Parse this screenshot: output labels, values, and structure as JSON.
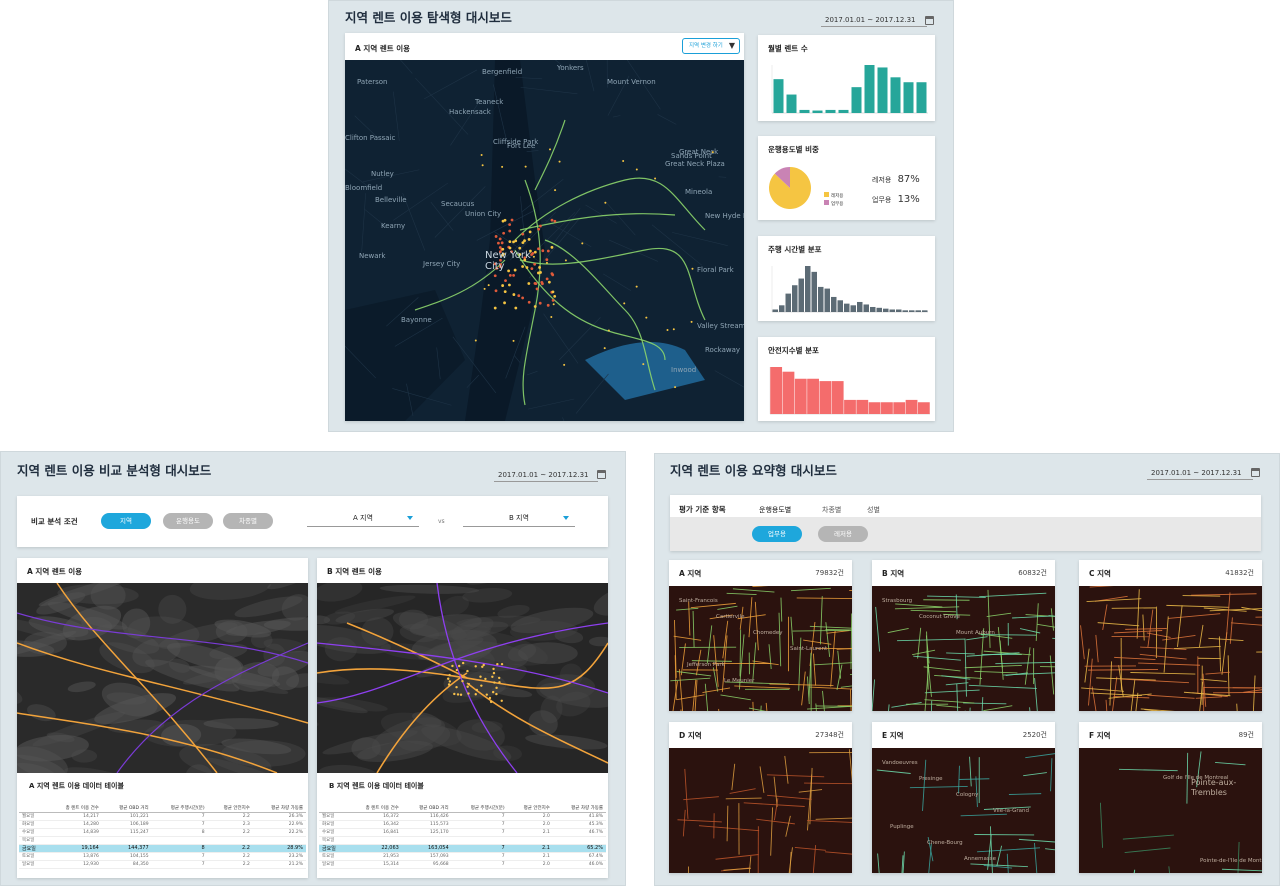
{
  "top": {
    "title": "지역 렌트 이용 탐색형 대시보드",
    "date_range": "2017.01.01 ~ 2017.12.31",
    "map_card": {
      "title": "A 지역 렌트 이용",
      "filter_button": "지역 변경 하기",
      "labels": [
        "Paterson",
        "Yonkers",
        "Bergenfield",
        "Mount Vernon",
        "Teaneck",
        "Hackensack",
        "Clifton Passaic",
        "Fort Lee",
        "Cliffside Park",
        "Nutley",
        "Bloomfield",
        "Belleville",
        "Secaucus",
        "Union City",
        "Kearny",
        "Newark",
        "Jersey City",
        "New York City",
        "Bayonne",
        "Great Neck",
        "Mineola",
        "Floral Park",
        "Valley Stream",
        "Sands Point",
        "Inwood",
        "Rockaway",
        "Great Neck Plaza",
        "New Hyde Park"
      ]
    },
    "monthly": {
      "title": "월별 렌트 수",
      "values": [
        55,
        30,
        5,
        4,
        5,
        5,
        42,
        78,
        74,
        58,
        50,
        50
      ],
      "color": "#26a69a"
    },
    "purpose": {
      "title": "운행용도별 비중",
      "items": [
        {
          "name": "레저용",
          "pct": "87%",
          "value": 87,
          "color": "#f5c542"
        },
        {
          "name": "업무용",
          "pct": "13%",
          "value": 13,
          "color": "#c983b4"
        }
      ]
    },
    "drive_time": {
      "title": "주행 시간별 분포",
      "values": [
        3,
        8,
        22,
        32,
        40,
        55,
        48,
        30,
        28,
        18,
        14,
        10,
        8,
        12,
        9,
        6,
        5,
        4,
        3,
        3,
        2,
        2,
        2,
        2
      ],
      "color": "#5c6b75"
    },
    "safety": {
      "title": "안전지수별 분포",
      "values": [
        40,
        36,
        30,
        30,
        28,
        28,
        12,
        12,
        10,
        10,
        10,
        12,
        10
      ],
      "color": "#f46c6c"
    }
  },
  "compare": {
    "title": "지역 렌트 이용 비교 분석형 대시보드",
    "date_range": "2017.01.01 ~ 2017.12.31",
    "condition_label": "비교 분석 조건",
    "pills": [
      {
        "label": "지역",
        "active": true
      },
      {
        "label": "운행용도",
        "active": false
      },
      {
        "label": "차종별",
        "active": false
      }
    ],
    "region_a": "A 지역",
    "vs": "vs",
    "region_b": "B 지역",
    "map_a_title": "A 지역 렌트 이용",
    "map_b_title": "B 지역 렌트 이용",
    "table_a": {
      "title": "A 지역 렌트 이용 데이터 테이블",
      "headers": [
        "",
        "총 렌트 이용 건수",
        "평균 OBD 거리",
        "평균 주행시간(분)",
        "평균 안전지수",
        "평균 차량 가동률"
      ],
      "rows": [
        [
          "월요일",
          "14,217",
          "101,221",
          "7",
          "2.2",
          "26.3%"
        ],
        [
          "화요일",
          "14,280",
          "106,189",
          "7",
          "2.3",
          "22.9%"
        ],
        [
          "수요일",
          "14,839",
          "115,247",
          "8",
          "2.2",
          "22.2%"
        ],
        [
          "목요일",
          "",
          "",
          "",
          "",
          ""
        ],
        [
          "금요일",
          "19,164",
          "144,377",
          "8",
          "2.2",
          "28.9%"
        ],
        [
          "토요일",
          "13,876",
          "104,155",
          "7",
          "2.2",
          "23.2%"
        ],
        [
          "일요일",
          "12,930",
          "84,350",
          "7",
          "2.2",
          "21.2%"
        ]
      ],
      "highlight_row": 4
    },
    "table_b": {
      "title": "B 지역 렌트 이용 데이터 테이블",
      "headers": [
        "",
        "총 렌트 이용 건수",
        "평균 OBD 거리",
        "평균 주행시간(분)",
        "평균 안전지수",
        "평균 차량 가동률"
      ],
      "rows": [
        [
          "월요일",
          "16,372",
          "116,426",
          "7",
          "2.0",
          "41.8%"
        ],
        [
          "화요일",
          "16,342",
          "115,573",
          "7",
          "2.0",
          "45.3%"
        ],
        [
          "수요일",
          "16,841",
          "125,170",
          "7",
          "2.1",
          "46.7%"
        ],
        [
          "목요일",
          "",
          "",
          "",
          "",
          ""
        ],
        [
          "금요일",
          "22,063",
          "163,054",
          "7",
          "2.1",
          "65.2%"
        ],
        [
          "토요일",
          "21,953",
          "157,093",
          "7",
          "2.1",
          "67.4%"
        ],
        [
          "일요일",
          "15,314",
          "95,668",
          "7",
          "2.0",
          "46.0%"
        ]
      ],
      "highlight_row": 4
    }
  },
  "summary": {
    "title": "지역 렌트 이용 요약형 대시보드",
    "date_range": "2017.01.01 ~ 2017.12.31",
    "criteria_label": "평가 기준 항목",
    "tabs": [
      {
        "label": "운행용도별",
        "active": true
      },
      {
        "label": "차종별",
        "active": false
      },
      {
        "label": "성별",
        "active": false
      }
    ],
    "sub_pills": [
      {
        "label": "업무용",
        "active": true
      },
      {
        "label": "레저용",
        "active": false
      }
    ],
    "regions": [
      {
        "name": "A 지역",
        "count": "79832건"
      },
      {
        "name": "B 지역",
        "count": "60832건"
      },
      {
        "name": "C 지역",
        "count": "41832건"
      },
      {
        "name": "D 지역",
        "count": "27348건"
      },
      {
        "name": "E 지역",
        "count": "2520건"
      },
      {
        "name": "F 지역",
        "count": "89건"
      }
    ],
    "map_labels": {
      "a": [
        "Saint-Francois",
        "Cartiervile",
        "Chomedey",
        "Saint-Laurent",
        "Jefferson Park",
        "Le Meunier"
      ],
      "b": [
        "Strasbourg",
        "Coconut Grove",
        "Mount Auburn"
      ],
      "e": [
        "Vandoeuvres",
        "Presinge",
        "Cologny",
        "Vile-la-Grand",
        "Puplinge",
        "Chene-Bourg",
        "Annemasse"
      ],
      "f": [
        "Pointe-aux-",
        "Trembles",
        "Golf de l'Ile de Montreal",
        "Pointe-de-l'Ile de Montreal"
      ]
    }
  }
}
